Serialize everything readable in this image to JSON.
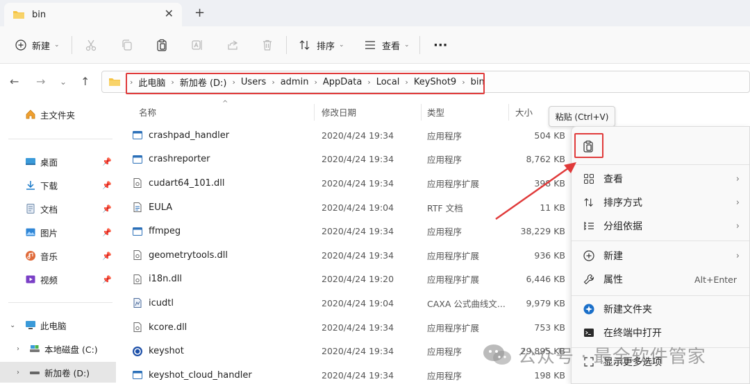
{
  "tab": {
    "title": "bin",
    "close": "✕",
    "add": "+"
  },
  "toolbar": {
    "new_label": "新建",
    "sort_label": "排序",
    "view_label": "查看",
    "more_label": "···"
  },
  "address": {
    "crumbs": [
      "此电脑",
      "新加卷 (D:)",
      "Users",
      "admin",
      "AppData",
      "Local",
      "KeyShot9",
      "bin"
    ]
  },
  "sidebar": {
    "home": "主文件夹",
    "quick": [
      "桌面",
      "下载",
      "文档",
      "图片",
      "音乐",
      "视频"
    ],
    "this_pc": "此电脑",
    "drives": [
      "本地磁盘 (C:)",
      "新加卷 (D:)"
    ]
  },
  "columns": {
    "name": "名称",
    "date": "修改日期",
    "type": "类型",
    "size": "大小"
  },
  "files": [
    {
      "name": "crashpad_handler",
      "date": "2020/4/24 19:34",
      "type": "应用程序",
      "size": "504 KB",
      "icon": "app-icon"
    },
    {
      "name": "crashreporter",
      "date": "2020/4/24 19:34",
      "type": "应用程序",
      "size": "8,762 KB",
      "icon": "app-icon"
    },
    {
      "name": "cudart64_101.dll",
      "date": "2020/4/24 19:34",
      "type": "应用程序扩展",
      "size": "398 KB",
      "icon": "dll-icon"
    },
    {
      "name": "EULA",
      "date": "2020/4/24 19:04",
      "type": "RTF 文档",
      "size": "11 KB",
      "icon": "rtf-icon"
    },
    {
      "name": "ffmpeg",
      "date": "2020/4/24 19:34",
      "type": "应用程序",
      "size": "38,229 KB",
      "icon": "app-icon"
    },
    {
      "name": "geometrytools.dll",
      "date": "2020/4/24 19:34",
      "type": "应用程序扩展",
      "size": "936 KB",
      "icon": "dll-icon"
    },
    {
      "name": "i18n.dll",
      "date": "2020/4/24 19:20",
      "type": "应用程序扩展",
      "size": "6,446 KB",
      "icon": "dll-icon"
    },
    {
      "name": "icudtl",
      "date": "2020/4/24 19:04",
      "type": "CAXA 公式曲线文...",
      "size": "9,979 KB",
      "icon": "caxa-icon"
    },
    {
      "name": "kcore.dll",
      "date": "2020/4/24 19:34",
      "type": "应用程序扩展",
      "size": "753 KB",
      "icon": "dll-icon"
    },
    {
      "name": "keyshot",
      "date": "2020/4/24 19:34",
      "type": "应用程序",
      "size": "29,895 KB",
      "icon": "keyshot-icon"
    },
    {
      "name": "keyshot_cloud_handler",
      "date": "2020/4/24 19:34",
      "type": "应用程序",
      "size": "198 KB",
      "icon": "app-icon"
    }
  ],
  "tooltip": "粘贴 (Ctrl+V)",
  "context_menu": {
    "view": "查看",
    "sort": "排序方式",
    "group": "分组依据",
    "new": "新建",
    "properties": "属性",
    "properties_shortcut": "Alt+Enter",
    "new_folder": "新建文件夹",
    "open_terminal": "在终端中打开",
    "more_options": "显示更多选项"
  },
  "watermark": "公众号 · 最全软件管家",
  "colors": {
    "highlight": "#e03a3a",
    "accent": "#0067c0",
    "folder": "#f5c342"
  }
}
